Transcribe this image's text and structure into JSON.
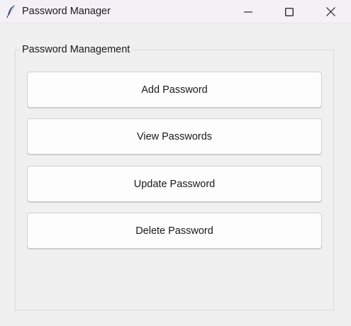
{
  "window": {
    "title": "Password Manager",
    "app_icon": "feather-icon",
    "controls": {
      "minimize_icon": "minimize-icon",
      "maximize_icon": "maximize-icon",
      "close_icon": "close-icon"
    }
  },
  "frame": {
    "title": "Password Management"
  },
  "buttons": {
    "add": "Add Password",
    "view": "View Passwords",
    "update": "Update Password",
    "delete": "Delete Password"
  },
  "colors": {
    "background": "#f0f0f0",
    "titlebar": "#f3f1f6",
    "button": "#fdfdfd",
    "border": "#d0d0d0"
  }
}
